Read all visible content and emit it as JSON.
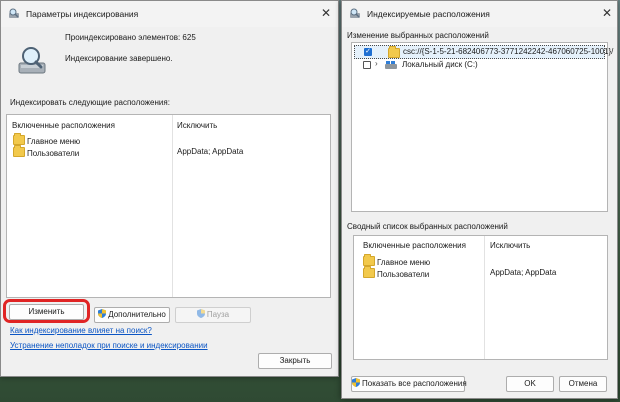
{
  "left_window": {
    "title": "Параметры индексирования",
    "indexed_count": "Проиндексировано элементов: 625",
    "status": "Индексирование завершено.",
    "section_label": "Индексировать следующие расположения:",
    "columns": [
      "Включенные расположения",
      "Исключить"
    ],
    "rows": [
      {
        "location": "Главное меню",
        "exclude": ""
      },
      {
        "location": "Пользователи",
        "exclude": "AppData; AppData"
      }
    ],
    "buttons": {
      "modify": "Изменить",
      "advanced": "Дополнительно",
      "pause": "Пауза",
      "close": "Закрыть"
    },
    "links": {
      "how_affects": "Как индексирование влияет на поиск?",
      "troubleshoot": "Устранение неполадок при поиске и индексировании"
    }
  },
  "right_window": {
    "title": "Индексируемые расположения",
    "change_group_label": "Изменение выбранных расположений",
    "tree": [
      {
        "label": "csc://{S-1-5-21-682406773-3771242242-467060725-1001}/",
        "checked": true,
        "icon": "folder-icon"
      },
      {
        "label": "Локальный диск (C:)",
        "checked": false,
        "icon": "drive-icon"
      }
    ],
    "summary_group_label": "Сводный список выбранных расположений",
    "columns": [
      "Включенные расположения",
      "Исключить"
    ],
    "rows": [
      {
        "location": "Главное меню",
        "exclude": ""
      },
      {
        "location": "Пользователи",
        "exclude": "AppData; AppData"
      }
    ],
    "buttons": {
      "show_all": "Показать все расположения",
      "ok": "OK",
      "cancel": "Отмена"
    }
  },
  "colors": {
    "highlight_ring": "#e02424",
    "link": "#0b55c4",
    "window_bg": "#f0f0f0"
  }
}
